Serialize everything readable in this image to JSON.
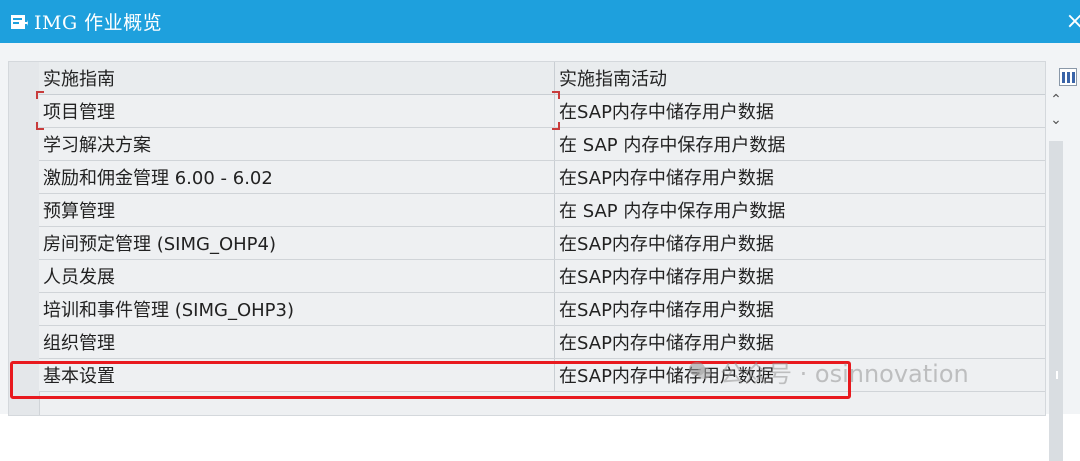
{
  "window": {
    "title": "IMG 作业概览",
    "close_glyph": "×"
  },
  "table": {
    "headers": [
      "实施指南",
      "实施指南活动"
    ],
    "rows": [
      {
        "guide": "项目管理",
        "activity": "在SAP内存中储存用户数据"
      },
      {
        "guide": "学习解决方案",
        "activity": "在 SAP 内存中保存用户数据"
      },
      {
        "guide": "激励和佣金管理 6.00 - 6.02",
        "activity": "在SAP内存中储存用户数据"
      },
      {
        "guide": "预算管理",
        "activity": "在 SAP 内存中保存用户数据"
      },
      {
        "guide": "房间预定管理 (SIMG_OHP4)",
        "activity": "在SAP内存中储存用户数据"
      },
      {
        "guide": "人员发展",
        "activity": "在SAP内存中储存用户数据"
      },
      {
        "guide": "培训和事件管理 (SIMG_OHP3)",
        "activity": "在SAP内存中储存用户数据"
      },
      {
        "guide": "组织管理",
        "activity": "在SAP内存中储存用户数据"
      },
      {
        "guide": "基本设置",
        "activity": "在SAP内存中储存用户数据"
      }
    ],
    "selected_row": 8
  },
  "icons": {
    "title": "document-arrow-icon",
    "column_config": "column-layout-icon",
    "scroll_up": "chevron-up-icon",
    "scroll_down": "chevron-down-icon"
  },
  "colors": {
    "titlebar": "#1ea0dd",
    "highlight": "#e8191e"
  },
  "watermark": {
    "text": "公众号 · osinnovation"
  }
}
